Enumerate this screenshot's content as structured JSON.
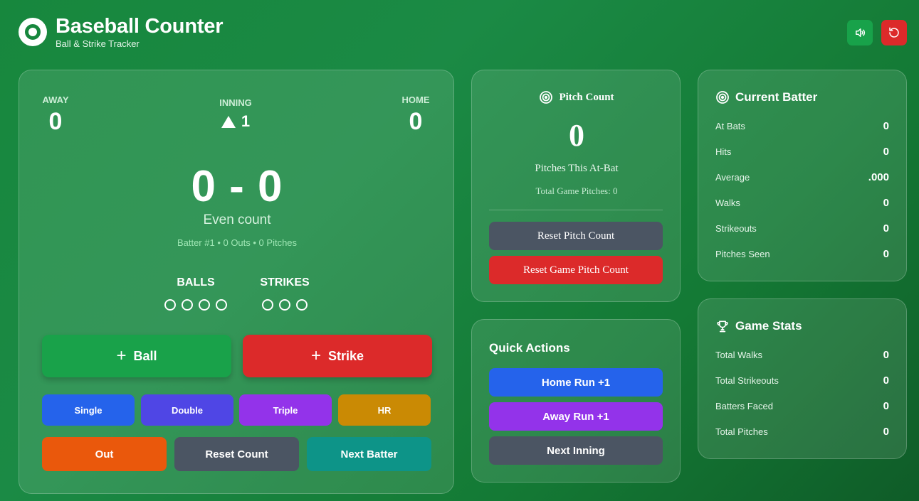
{
  "app": {
    "title": "Baseball Counter",
    "subtitle": "Ball & Strike Tracker"
  },
  "header_icons": [
    "volume-icon",
    "refresh-icon"
  ],
  "scoreboard": {
    "away_label": "AWAY",
    "away_score": "0",
    "inning_label": "INNING",
    "inning_value": "1",
    "inning_half": "top",
    "home_label": "HOME",
    "home_score": "0"
  },
  "count": {
    "display": "0 - 0",
    "description": "Even count",
    "info": "Batter #1 • 0 Outs • 0 Pitches",
    "balls_label": "BALLS",
    "balls": 0,
    "balls_max": 4,
    "strikes_label": "STRIKES",
    "strikes": 0,
    "strikes_max": 3
  },
  "actions": {
    "ball": "Ball",
    "strike": "Strike",
    "single": "Single",
    "double": "Double",
    "triple": "Triple",
    "hr": "HR",
    "out": "Out",
    "reset_count": "Reset Count",
    "next_batter": "Next Batter"
  },
  "pitch_count": {
    "title": "Pitch Count",
    "value": "0",
    "description": "Pitches This At-Bat",
    "total": "Total Game Pitches: 0",
    "reset_pitch": "Reset Pitch Count",
    "reset_game": "Reset Game Pitch Count"
  },
  "quick_actions": {
    "title": "Quick Actions",
    "home_run": "Home Run +1",
    "away_run": "Away Run +1",
    "next_inning": "Next Inning"
  },
  "current_batter": {
    "title": "Current Batter",
    "rows": [
      {
        "label": "At Bats",
        "value": "0"
      },
      {
        "label": "Hits",
        "value": "0"
      },
      {
        "label": "Average",
        "value": ".000"
      },
      {
        "label": "Walks",
        "value": "0"
      },
      {
        "label": "Strikeouts",
        "value": "0"
      },
      {
        "label": "Pitches Seen",
        "value": "0"
      }
    ]
  },
  "game_stats": {
    "title": "Game Stats",
    "rows": [
      {
        "label": "Total Walks",
        "value": "0"
      },
      {
        "label": "Total Strikeouts",
        "value": "0"
      },
      {
        "label": "Batters Faced",
        "value": "0"
      },
      {
        "label": "Total Pitches",
        "value": "0"
      }
    ]
  },
  "colors": {
    "background": "#17873d",
    "ball": "#19a24a",
    "strike": "#dc2a2a",
    "single": "#2563eb",
    "double": "#4f46e5",
    "triple": "#9333ea",
    "hr": "#ca8a04",
    "out": "#ea580c",
    "neutral": "#4b5563",
    "next": "#0d9488"
  }
}
